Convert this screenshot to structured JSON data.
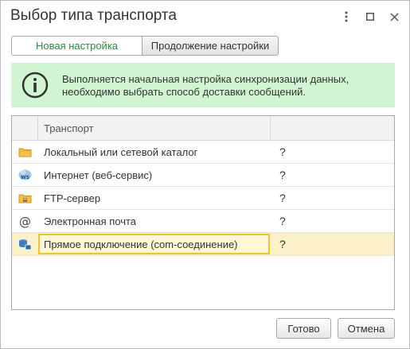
{
  "window": {
    "title": "Выбор типа транспорта"
  },
  "tabs": [
    {
      "label": "Новая настройка",
      "active": true
    },
    {
      "label": "Продолжение настройки",
      "active": false
    }
  ],
  "info": {
    "icon": "info-icon",
    "text": "Выполняется начальная настройка синхронизации данных, необходимо выбрать способ доставки сообщений."
  },
  "table": {
    "column_header": "Транспорт",
    "rows": [
      {
        "icon": "folder-icon",
        "name": "Локальный или сетевой каталог",
        "status": "?"
      },
      {
        "icon": "web-service-icon",
        "name": "Интернет (веб-сервис)",
        "status": "?"
      },
      {
        "icon": "ftp-folder-icon",
        "name": "FTP-сервер",
        "status": "?"
      },
      {
        "icon": "at-sign-icon",
        "name": "Электронная почта",
        "status": "?"
      },
      {
        "icon": "database-connection-icon",
        "name": "Прямое подключение (com-соединение)",
        "status": "?",
        "selected": true
      }
    ]
  },
  "buttons": {
    "ok": "Готово",
    "cancel": "Отмена"
  },
  "colors": {
    "active_tab_text": "#2c8a3f",
    "info_background": "#d1f5d3",
    "selected_row": "#fbf0c8",
    "selection_border": "#f1c232"
  }
}
